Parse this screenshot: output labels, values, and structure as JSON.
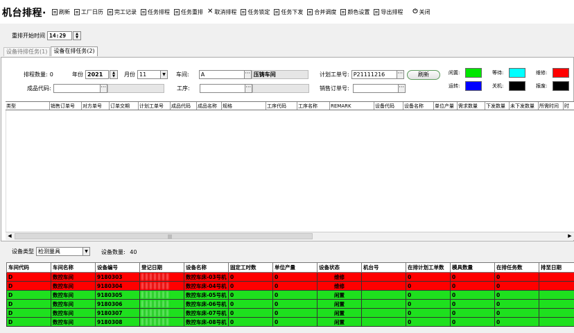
{
  "app": {
    "title": "机台排程·"
  },
  "toolbar": [
    {
      "label": "刷新",
      "icon": "list-icon"
    },
    {
      "label": "工厂日历",
      "icon": "list-icon"
    },
    {
      "label": "完工记录",
      "icon": "list-icon"
    },
    {
      "label": "任务排程",
      "icon": "list-icon"
    },
    {
      "label": "任务重排",
      "icon": "list-icon"
    },
    {
      "label": "取消排程",
      "icon": "close-icon"
    },
    {
      "label": "任务锁定",
      "icon": "list-icon"
    },
    {
      "label": "任务下发",
      "icon": "list-icon"
    },
    {
      "label": "合并调度",
      "icon": "list-icon"
    },
    {
      "label": "颜色设置",
      "icon": "list-icon"
    },
    {
      "label": "导出排程",
      "icon": "list-icon"
    },
    {
      "label": "关闭",
      "icon": "power-icon"
    }
  ],
  "restart": {
    "label": "重排开始时间",
    "value": "14:29"
  },
  "tabs": [
    {
      "label": "设备待排任务(1)",
      "active": false
    },
    {
      "label": "设备在排任务(2)",
      "active": true
    }
  ],
  "filters": {
    "count_label": "排程数量:",
    "count_value": "0",
    "year_label": "年份",
    "year_value": "2021",
    "month_label": "月份",
    "month_value": "11",
    "workshop_label": "车间:",
    "workshop_code": "A",
    "workshop_name": "压铸车间",
    "plan_no_label": "计划工单号:",
    "plan_no_value": "P21111216",
    "refresh_label": "刷新",
    "product_code_label": "成品代码:",
    "product_code_value": "",
    "process_label": "工序:",
    "process_value": "",
    "sales_no_label": "销售订单号:",
    "sales_no_value": ""
  },
  "legend": [
    {
      "label": "闲置:",
      "color": "#00e600"
    },
    {
      "label": "等待:",
      "color": "#00ffff"
    },
    {
      "label": "维修:",
      "color": "#ff0000"
    },
    {
      "label": "运转:",
      "color": "#0000ff"
    },
    {
      "label": "关机:",
      "color": "#000000"
    },
    {
      "label": "报废:",
      "color": "#000000"
    }
  ],
  "task_grid": {
    "columns": [
      "类型",
      "销售订单号",
      "对方单号",
      "订单交期",
      "计划工单号",
      "成品代码",
      "成品名称",
      "规格",
      "工序代码",
      "工序名称",
      "REMARK",
      "设备代码",
      "设备名称",
      "单位产量",
      "需求数量",
      "下发数量",
      "未下发数量",
      "所需时间",
      "时"
    ]
  },
  "equipment": {
    "type_label": "设备类型",
    "type_value": "检测量具",
    "count_label": "设备数量:",
    "count_value": "40",
    "columns": [
      "车间代码",
      "车间名称",
      "设备编号",
      "登记日期",
      "设备名称",
      "固定工时数",
      "单位产量",
      "设备状态",
      "机台号",
      "在排计划工单数",
      "模具数量",
      "在排任务数",
      "排至日期"
    ],
    "rows": [
      {
        "code": "D",
        "workshop": "数控车间",
        "no": "9180303",
        "name": "数控车床-03号机",
        "hours": "0",
        "unit": "0",
        "status": "维修",
        "machine": "",
        "plans": "0",
        "molds": "0",
        "tasks": "0",
        "color": "#ff0000"
      },
      {
        "code": "D",
        "workshop": "数控车间",
        "no": "9180304",
        "name": "数控车床-04号机",
        "hours": "0",
        "unit": "0",
        "status": "维修",
        "machine": "",
        "plans": "0",
        "molds": "0",
        "tasks": "0",
        "color": "#ff0000"
      },
      {
        "code": "D",
        "workshop": "数控车间",
        "no": "9180305",
        "name": "数控车床-05号机",
        "hours": "0",
        "unit": "0",
        "status": "闲置",
        "machine": "",
        "plans": "0",
        "molds": "0",
        "tasks": "0",
        "color": "#1ee01e"
      },
      {
        "code": "D",
        "workshop": "数控车间",
        "no": "9180306",
        "name": "数控车床-06号机",
        "hours": "0",
        "unit": "0",
        "status": "闲置",
        "machine": "",
        "plans": "0",
        "molds": "0",
        "tasks": "0",
        "color": "#1ee01e"
      },
      {
        "code": "D",
        "workshop": "数控车间",
        "no": "9180307",
        "name": "数控车床-07号机",
        "hours": "0",
        "unit": "0",
        "status": "闲置",
        "machine": "",
        "plans": "0",
        "molds": "0",
        "tasks": "0",
        "color": "#1ee01e"
      },
      {
        "code": "D",
        "workshop": "数控车间",
        "no": "9180308",
        "name": "数控车床-08号机",
        "hours": "0",
        "unit": "0",
        "status": "闲置",
        "machine": "",
        "plans": "0",
        "molds": "0",
        "tasks": "0",
        "color": "#1ee01e"
      }
    ]
  }
}
